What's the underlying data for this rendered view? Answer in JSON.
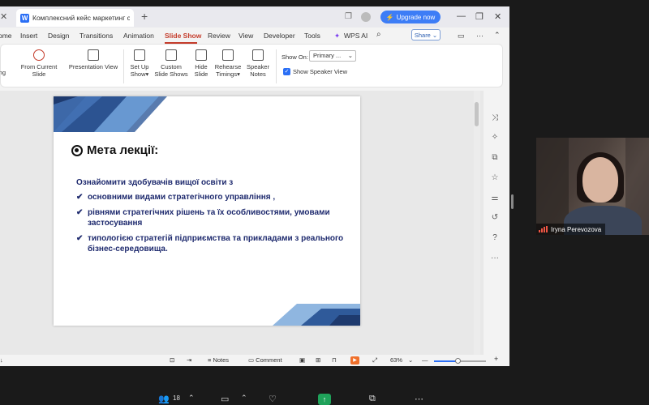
{
  "titlebar": {
    "tab_title": "Комплексний кейс маркетинг стра",
    "tab_app_letter": "W",
    "upgrade_label": "Upgrade now"
  },
  "menu": {
    "items": [
      "ome",
      "Insert",
      "Design",
      "Transitions",
      "Animation",
      "Slide Show",
      "Review",
      "View",
      "Developer",
      "Tools",
      "WPS AI"
    ],
    "active": "Slide Show",
    "share_label": "Share"
  },
  "ribbon": {
    "buttons": [
      {
        "line1": "ing",
        "line2": ""
      },
      {
        "line1": "From Current Slide",
        "line2": ""
      },
      {
        "line1": "Presentation View",
        "line2": ""
      },
      {
        "line1": "Set Up",
        "line2": "Show▾"
      },
      {
        "line1": "Custom",
        "line2": "Slide Shows"
      },
      {
        "line1": "Hide",
        "line2": "Slide"
      },
      {
        "line1": "Rehearse",
        "line2": "Timings▾"
      },
      {
        "line1": "Speaker",
        "line2": "Notes"
      }
    ],
    "show_on_label": "Show On:",
    "show_on_value": "Primary ...",
    "speaker_view_label": "Show Speaker View",
    "speaker_view_checked": true
  },
  "slide": {
    "title": "Мета лекції:",
    "intro": "Ознайомити здобувачів вищої освіти з",
    "bullets": [
      "основними видами стратегічного управління ,",
      "рівнями  стратегічних рішень та їх особливостями, умовами застосування",
      "типологією стратегій підприємства та прикладами з реального бізнес-середовища."
    ]
  },
  "statusbar": {
    "notes_label": "Notes",
    "comment_label": "Comment",
    "zoom": "63%",
    "zoom_fraction": 0.45
  },
  "video": {
    "participant_name": "Iryna Perevozova"
  },
  "meeting": {
    "participants_count": "18"
  },
  "colors": {
    "accent": "#c43b2a",
    "upgrade": "#3d7df6",
    "slide_text": "#1e2a6e"
  }
}
